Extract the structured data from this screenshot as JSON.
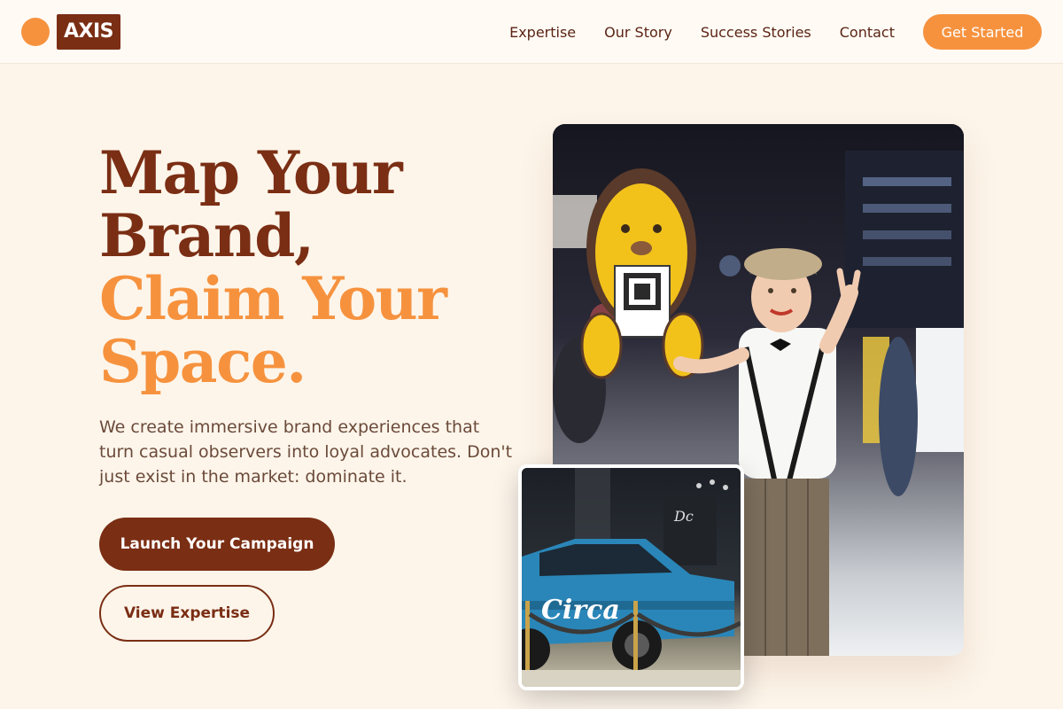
{
  "brand": {
    "name": "AXIS",
    "accent": "#f6923e",
    "primary": "#7a2e14",
    "background": "#fdf5ea"
  },
  "nav": {
    "items": [
      "Expertise",
      "Our Story",
      "Success Stories",
      "Contact"
    ],
    "cta": "Get Started"
  },
  "hero": {
    "headline_line1": "Map Your",
    "headline_line2": "Brand,",
    "headline_line3": "Claim Your",
    "headline_line4": "Space.",
    "subtext": "We create immersive brand experiences that turn casual observers into loyal advocates. Don't just exist in the market: dominate it.",
    "primary_button": "Launch Your Campaign",
    "secondary_button": "View Expertise"
  },
  "images": {
    "main_photo": "brand-ambassador-photo",
    "secondary_photo": "car-showroom-photo",
    "car_brand_text": "Circa"
  }
}
